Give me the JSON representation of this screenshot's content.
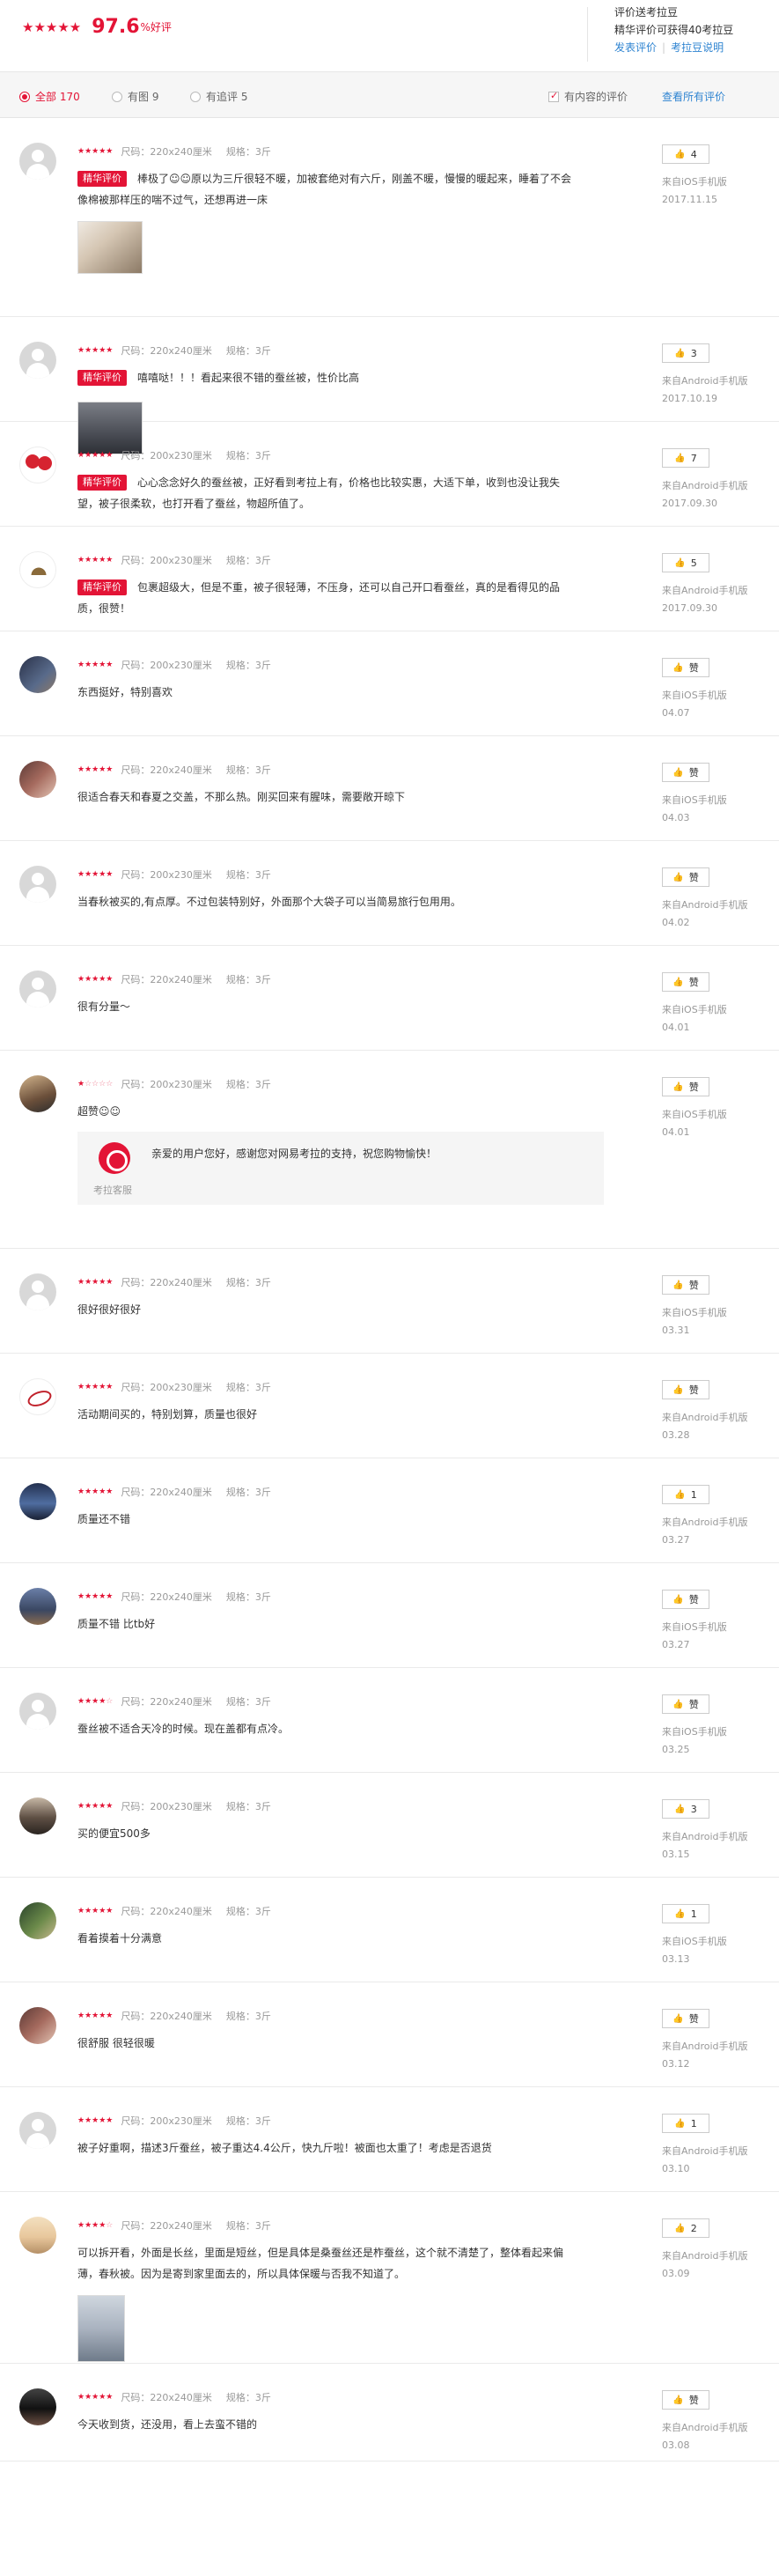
{
  "summary": {
    "stars": "★★★★★",
    "percent": "97.6",
    "percent_unit": "%好评",
    "info_line1": "评价送考拉豆",
    "info_line2": "精华评价可获得40考拉豆",
    "link_post": "发表评价",
    "link_sep": "|",
    "link_explain": "考拉豆说明"
  },
  "filters": {
    "all": "全部 170",
    "with_image": "有图 9",
    "appended": "有追评 5",
    "has_content": "有内容的评价",
    "view_all": "查看所有评价"
  },
  "colors": {
    "accent": "#e31436",
    "link": "#2f84d1"
  },
  "reviews": [
    {
      "avatar": "default",
      "stars": 5,
      "size": "尺码：220x240厘米",
      "spec": "规格：3斤",
      "badge": "精华评价",
      "text1": "棒极了☺☺原以为三斤很轻不暖，加被套绝对有六斤，刚盖不暖，慢慢的暖起来，睡着了不会",
      "text2": "像棉被那样压的喘不过气，还想再进一床",
      "image": "t1",
      "like": "4",
      "source": "来自iOS手机版",
      "date": "2017.11.15"
    },
    {
      "avatar": "default",
      "stars": 5,
      "size": "尺码：220x240厘米",
      "spec": "规格：3斤",
      "badge": "精华评价",
      "text1": "嘻嘻哒！！！看起来很不错的蚕丝被，性价比高",
      "text2": "",
      "image": "t2",
      "like": "3",
      "source": "来自Android手机版",
      "date": "2017.10.19"
    },
    {
      "avatar": "red",
      "stars": 5,
      "size": "尺码：200x230厘米",
      "spec": "规格：3斤",
      "badge": "精华评价",
      "text1": "心心念念好久的蚕丝被，正好看到考拉上有，价格也比较实惠，大适下单，收到也没让我失",
      "text2": "望，被子很柔软，也打开看了蚕丝，物超所值了。",
      "image": "",
      "like": "7",
      "source": "来自Android手机版",
      "date": "2017.09.30"
    },
    {
      "avatar": "adidas",
      "stars": 5,
      "size": "尺码：200x230厘米",
      "spec": "规格：3斤",
      "badge": "精华评价",
      "text1": "包裹超级大，但是不重，被子很轻薄，不压身，还可以自己开口看蚕丝，真的是看得见的品",
      "text2": "质，很赞！",
      "image": "",
      "like": "5",
      "source": "来自Android手机版",
      "date": "2017.09.30"
    },
    {
      "avatar": "dark",
      "stars": 5,
      "size": "尺码：200x230厘米",
      "spec": "规格：3斤",
      "badge": "",
      "text1": "东西挺好，特别喜欢",
      "text2": "",
      "image": "",
      "like": "赞",
      "source": "来自iOS手机版",
      "date": "04.07"
    },
    {
      "avatar": "lady",
      "stars": 5,
      "size": "尺码：220x240厘米",
      "spec": "规格：3斤",
      "badge": "",
      "text1": "很适合春天和春夏之交盖，不那么热。刚买回来有腥味，需要敞开晾下",
      "text2": "",
      "image": "",
      "like": "赞",
      "source": "来自iOS手机版",
      "date": "04.03"
    },
    {
      "avatar": "default",
      "stars": 5,
      "size": "尺码：200x230厘米",
      "spec": "规格：3斤",
      "badge": "",
      "text1": "当春秋被买的,有点厚。不过包装特别好，外面那个大袋子可以当简易旅行包用用。",
      "text2": "",
      "image": "",
      "like": "赞",
      "source": "来自Android手机版",
      "date": "04.02"
    },
    {
      "avatar": "default",
      "stars": 5,
      "size": "尺码：220x240厘米",
      "spec": "规格：3斤",
      "badge": "",
      "text1": "很有分量～",
      "text2": "",
      "image": "",
      "like": "赞",
      "source": "来自iOS手机版",
      "date": "04.01"
    },
    {
      "avatar": "photo",
      "stars": 1,
      "size": "尺码：200x230厘米",
      "spec": "规格：3斤",
      "badge": "",
      "text1": "超赞☺☺",
      "text2": "",
      "image": "",
      "like": "赞",
      "source": "来自iOS手机版",
      "date": "04.01",
      "reply": "亲爱的用户您好，感谢您对网易考拉的支持，祝您购物愉快！",
      "reply_name": "考拉客服"
    },
    {
      "avatar": "default",
      "stars": 5,
      "size": "尺码：220x240厘米",
      "spec": "规格：3斤",
      "badge": "",
      "text1": "很好很好很好",
      "text2": "",
      "image": "",
      "like": "赞",
      "source": "来自iOS手机版",
      "date": "03.31"
    },
    {
      "avatar": "sign",
      "stars": 5,
      "size": "尺码：200x230厘米",
      "spec": "规格：3斤",
      "badge": "",
      "text1": "活动期间买的，特别划算，质量也很好",
      "text2": "",
      "image": "",
      "like": "赞",
      "source": "来自Android手机版",
      "date": "03.28"
    },
    {
      "avatar": "night",
      "stars": 5,
      "size": "尺码：220x240厘米",
      "spec": "规格：3斤",
      "badge": "",
      "text1": "质量还不错",
      "text2": "",
      "image": "",
      "like": "1",
      "source": "来自Android手机版",
      "date": "03.27"
    },
    {
      "avatar": "city",
      "stars": 5,
      "size": "尺码：220x240厘米",
      "spec": "规格：3斤",
      "badge": "",
      "text1": "质量不错 比tb好",
      "text2": "",
      "image": "",
      "like": "赞",
      "source": "来自iOS手机版",
      "date": "03.27"
    },
    {
      "avatar": "default",
      "stars": 4,
      "size": "尺码：220x240厘米",
      "spec": "规格：3斤",
      "badge": "",
      "text1": "蚕丝被不适合天冷的时候。现在盖都有点冷。",
      "text2": "",
      "image": "",
      "like": "赞",
      "source": "来自iOS手机版",
      "date": "03.25"
    },
    {
      "avatar": "car",
      "stars": 5,
      "size": "尺码：200x230厘米",
      "spec": "规格：3斤",
      "badge": "",
      "text1": "买的便宜500多",
      "text2": "",
      "image": "",
      "like": "3",
      "source": "来自Android手机版",
      "date": "03.15"
    },
    {
      "avatar": "green",
      "stars": 5,
      "size": "尺码：220x240厘米",
      "spec": "规格：3斤",
      "badge": "",
      "text1": "看着摸着十分满意",
      "text2": "",
      "image": "",
      "like": "1",
      "source": "来自iOS手机版",
      "date": "03.13"
    },
    {
      "avatar": "lady",
      "stars": 5,
      "size": "尺码：220x240厘米",
      "spec": "规格：3斤",
      "badge": "",
      "text1": "很舒服 很轻很暖",
      "text2": "",
      "image": "",
      "like": "赞",
      "source": "来自Android手机版",
      "date": "03.12"
    },
    {
      "avatar": "default",
      "stars": 5,
      "size": "尺码：200x230厘米",
      "spec": "规格：3斤",
      "badge": "",
      "text1": "被子好重啊，描述3斤蚕丝，被子重达4.4公斤，快九斤啦！被面也太重了！考虑是否退货",
      "text2": "",
      "image": "",
      "like": "1",
      "source": "来自Android手机版",
      "date": "03.10"
    },
    {
      "avatar": "kid",
      "stars": 4,
      "size": "尺码：220x240厘米",
      "spec": "规格：3斤",
      "badge": "",
      "text1": "可以拆开看，外面是长丝，里面是短丝，但是具体是桑蚕丝还是柞蚕丝，这个就不清楚了，整体看起来偏",
      "text2": "薄，春秋被。因为是寄到家里面去的，所以具体保暖与否我不知道了。",
      "image": "t3",
      "like": "2",
      "source": "来自Android手机版",
      "date": "03.09"
    },
    {
      "avatar": "girl",
      "stars": 5,
      "size": "尺码：220x240厘米",
      "spec": "规格：3斤",
      "badge": "",
      "text1": "今天收到货，还没用，看上去蛮不错的",
      "text2": "",
      "image": "",
      "like": "赞",
      "source": "来自Android手机版",
      "date": "03.08"
    }
  ]
}
